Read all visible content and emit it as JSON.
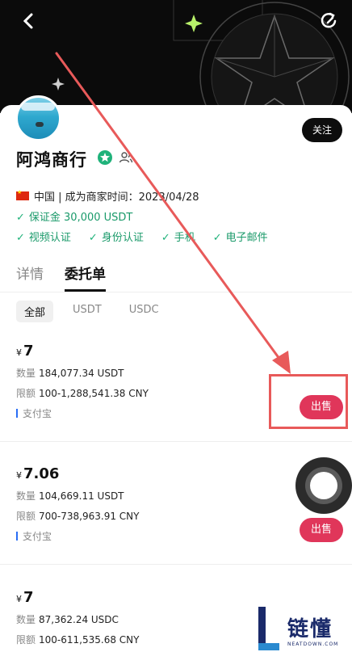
{
  "header": {
    "back_icon": "chevron-left-icon",
    "refresh_icon": "refresh-icon"
  },
  "profile": {
    "name": "阿鸿商行",
    "follow_label": "关注",
    "info": "中国 | 成为商家时间：2023/04/28",
    "deposit": "保证金 30,000 USDT",
    "verifications": [
      "视频认证",
      "身份认证",
      "手机",
      "电子邮件"
    ],
    "verified_color": "#1fb27a"
  },
  "tabs": [
    {
      "label": "详情",
      "active": false
    },
    {
      "label": "委托单",
      "active": true
    }
  ],
  "filters": [
    {
      "label": "全部",
      "active": true
    },
    {
      "label": "USDT",
      "active": false
    },
    {
      "label": "USDC",
      "active": false
    }
  ],
  "listings": [
    {
      "currency_symbol": "¥",
      "price": "7",
      "quantity_label": "数量",
      "quantity": "184,077.34 USDT",
      "limit_label": "限额",
      "limit": "100-1,288,541.38 CNY",
      "payment": "支付宝",
      "action": "出售"
    },
    {
      "currency_symbol": "¥",
      "price": "7.06",
      "quantity_label": "数量",
      "quantity": "104,669.11 USDT",
      "limit_label": "限额",
      "limit": "700-738,963.91 CNY",
      "payment": "支付宝",
      "action": "出售"
    },
    {
      "currency_symbol": "¥",
      "price": "7",
      "quantity_label": "数量",
      "quantity": "87,362.24 USDC",
      "limit_label": "限额",
      "limit": "100-611,535.68 CNY"
    }
  ],
  "colors": {
    "sell_button": "#e0365a",
    "annotation": "#e85a5a"
  },
  "watermark": {
    "cn": "链懂",
    "en": "NEATDOWN.COM"
  }
}
